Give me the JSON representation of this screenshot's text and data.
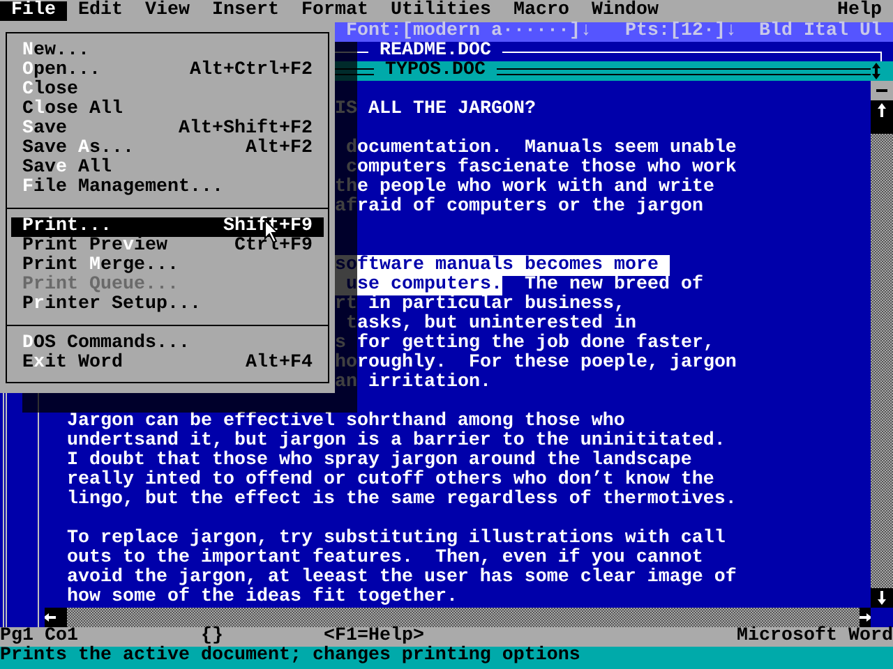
{
  "menu_bar": [
    {
      "label": "File",
      "selected": true
    },
    {
      "label": "Edit",
      "selected": false
    },
    {
      "label": "View",
      "selected": false
    },
    {
      "label": "Insert",
      "selected": false
    },
    {
      "label": "Format",
      "selected": false
    },
    {
      "label": "Utilities",
      "selected": false
    },
    {
      "label": "Macro",
      "selected": false
    },
    {
      "label": "Window",
      "selected": false
    },
    {
      "label": "Help",
      "selected": false
    }
  ],
  "ruler": {
    "font": "Font:[modern a······]↓",
    "points": "Pts:[12·]↓",
    "styles": [
      "Bld",
      "Ital",
      "Ul"
    ]
  },
  "windows": [
    {
      "title": "README.DOC",
      "active": false
    },
    {
      "title": "TYPOS.DOC",
      "active": true
    }
  ],
  "file_menu": {
    "items": [
      {
        "kind": "item",
        "parts": [
          {
            "text": "N",
            "hotkey": true
          },
          {
            "text": "ew...",
            "hotkey": false
          }
        ],
        "selected": false,
        "disabled": false
      },
      {
        "kind": "item",
        "parts": [
          {
            "text": "O",
            "hotkey": true
          },
          {
            "text": "pen...",
            "hotkey": false
          }
        ],
        "shortcut": "Alt+Ctrl+F2",
        "selected": false,
        "disabled": false
      },
      {
        "kind": "item",
        "parts": [
          {
            "text": "C",
            "hotkey": true
          },
          {
            "text": "lose",
            "hotkey": false
          }
        ],
        "selected": false,
        "disabled": false
      },
      {
        "kind": "item",
        "parts": [
          {
            "text": "C",
            "hotkey": false
          },
          {
            "text": "l",
            "hotkey": true
          },
          {
            "text": "ose All",
            "hotkey": false
          }
        ],
        "selected": false,
        "disabled": false
      },
      {
        "kind": "item",
        "parts": [
          {
            "text": "S",
            "hotkey": true
          },
          {
            "text": "ave",
            "hotkey": false
          }
        ],
        "shortcut": "Alt+Shift+F2",
        "selected": false,
        "disabled": false
      },
      {
        "kind": "item",
        "parts": [
          {
            "text": "Save ",
            "hotkey": false
          },
          {
            "text": "A",
            "hotkey": true
          },
          {
            "text": "s...",
            "hotkey": false
          }
        ],
        "shortcut": "Alt+F2",
        "selected": false,
        "disabled": false
      },
      {
        "kind": "item",
        "parts": [
          {
            "text": "Sav",
            "hotkey": false
          },
          {
            "text": "e",
            "hotkey": true
          },
          {
            "text": " All",
            "hotkey": false
          }
        ],
        "selected": false,
        "disabled": false
      },
      {
        "kind": "item",
        "parts": [
          {
            "text": "F",
            "hotkey": true
          },
          {
            "text": "ile Management...",
            "hotkey": false
          }
        ],
        "selected": false,
        "disabled": false
      },
      {
        "kind": "separator"
      },
      {
        "kind": "item",
        "parts": [
          {
            "text": "Print...",
            "hotkey": false
          }
        ],
        "shortcut": "Shift+F9",
        "selected": true,
        "disabled": false
      },
      {
        "kind": "item",
        "parts": [
          {
            "text": "Print Pre",
            "hotkey": false
          },
          {
            "text": "v",
            "hotkey": true
          },
          {
            "text": "iew",
            "hotkey": false
          }
        ],
        "shortcut": "Ctrl+F9",
        "selected": false,
        "disabled": false
      },
      {
        "kind": "item",
        "parts": [
          {
            "text": "Print ",
            "hotkey": false
          },
          {
            "text": "M",
            "hotkey": true
          },
          {
            "text": "erge...",
            "hotkey": false
          }
        ],
        "selected": false,
        "disabled": false
      },
      {
        "kind": "item",
        "parts": [
          {
            "text": "Print Queue...",
            "hotkey": false
          }
        ],
        "selected": false,
        "disabled": true
      },
      {
        "kind": "item",
        "parts": [
          {
            "text": "P",
            "hotkey": false
          },
          {
            "text": "r",
            "hotkey": true
          },
          {
            "text": "inter Setup...",
            "hotkey": false
          }
        ],
        "selected": false,
        "disabled": false
      },
      {
        "kind": "separator"
      },
      {
        "kind": "item",
        "parts": [
          {
            "text": "D",
            "hotkey": true
          },
          {
            "text": "OS Commands...",
            "hotkey": false
          }
        ],
        "selected": false,
        "disabled": false
      },
      {
        "kind": "item",
        "parts": [
          {
            "text": "E",
            "hotkey": false
          },
          {
            "text": "x",
            "hotkey": true
          },
          {
            "text": "it Word",
            "hotkey": false
          }
        ],
        "shortcut": "Alt+F4",
        "selected": false,
        "disabled": false
      }
    ]
  },
  "document": {
    "lines": [
      {
        "kind": "blank"
      },
      {
        "kind": "clipped",
        "segments": [
          {
            "text": "IS ALL THE JARGON?",
            "selected": false
          }
        ]
      },
      {
        "kind": "blank"
      },
      {
        "kind": "clipped",
        "segments": [
          {
            "text": " documentation.  Manuals seem unable",
            "selected": false
          }
        ]
      },
      {
        "kind": "clipped",
        "segments": [
          {
            "text": " computers fascienate those who work",
            "selected": false
          }
        ]
      },
      {
        "kind": "clipped",
        "segments": [
          {
            "text": "the people who work with and write",
            "selected": false
          }
        ]
      },
      {
        "kind": "clipped",
        "segments": [
          {
            "text": "afraid of computers or the jargon",
            "selected": false
          }
        ]
      },
      {
        "kind": "blank"
      },
      {
        "kind": "blank"
      },
      {
        "kind": "clipped",
        "segments": [
          {
            "text": "software manuals becomes more ",
            "selected": true
          }
        ]
      },
      {
        "kind": "clipped",
        "segments": [
          {
            "text": " use computers.",
            "selected": true
          },
          {
            "text": "  The new breed of",
            "selected": false
          }
        ]
      },
      {
        "kind": "clipped",
        "segments": [
          {
            "text": "rt in particular business,",
            "selected": false
          }
        ]
      },
      {
        "kind": "clipped",
        "segments": [
          {
            "text": " tasks, but uninterested in",
            "selected": false
          }
        ]
      },
      {
        "kind": "clipped",
        "segments": [
          {
            "text": "s for getting the job done faster,",
            "selected": false
          }
        ]
      },
      {
        "kind": "clipped",
        "segments": [
          {
            "text": "horoughly.  For these poeple, jargon",
            "selected": false
          }
        ]
      },
      {
        "kind": "clipped",
        "segments": [
          {
            "text": "an irritation.",
            "selected": false
          }
        ]
      },
      {
        "kind": "blank"
      },
      {
        "kind": "full",
        "segments": [
          {
            "text": "Jargon can be effectivel sohrthand among those who",
            "selected": false
          }
        ]
      },
      {
        "kind": "full",
        "segments": [
          {
            "text": "undertsand it, but jargon is a barrier to the uninititated.",
            "selected": false
          }
        ]
      },
      {
        "kind": "full",
        "segments": [
          {
            "text": "I doubt that those who spray jargon around the landscape",
            "selected": false
          }
        ]
      },
      {
        "kind": "full",
        "segments": [
          {
            "text": "really inted to offend or cutoff others who don’t know the",
            "selected": false
          }
        ]
      },
      {
        "kind": "full",
        "segments": [
          {
            "text": "lingo, but the effect is the same regardless of thermotives.",
            "selected": false
          }
        ]
      },
      {
        "kind": "blank"
      },
      {
        "kind": "full",
        "segments": [
          {
            "text": "To replace jargon, try substituting illustrations with call",
            "selected": false
          }
        ]
      },
      {
        "kind": "full",
        "segments": [
          {
            "text": "outs to the important features.  Then, even if you cannot",
            "selected": false
          }
        ]
      },
      {
        "kind": "full",
        "segments": [
          {
            "text": "avoid the jargon, at leeast the user has some clear image of",
            "selected": false
          }
        ]
      },
      {
        "kind": "full",
        "segments": [
          {
            "text": "how some of the ideas fit together.",
            "selected": false
          }
        ]
      }
    ]
  },
  "status_line": {
    "position": "Pg1 Co1",
    "braces": "{}",
    "help": "<F1=Help>",
    "app": "Microsoft Word"
  },
  "message": "Prints the active document; changes printing options"
}
